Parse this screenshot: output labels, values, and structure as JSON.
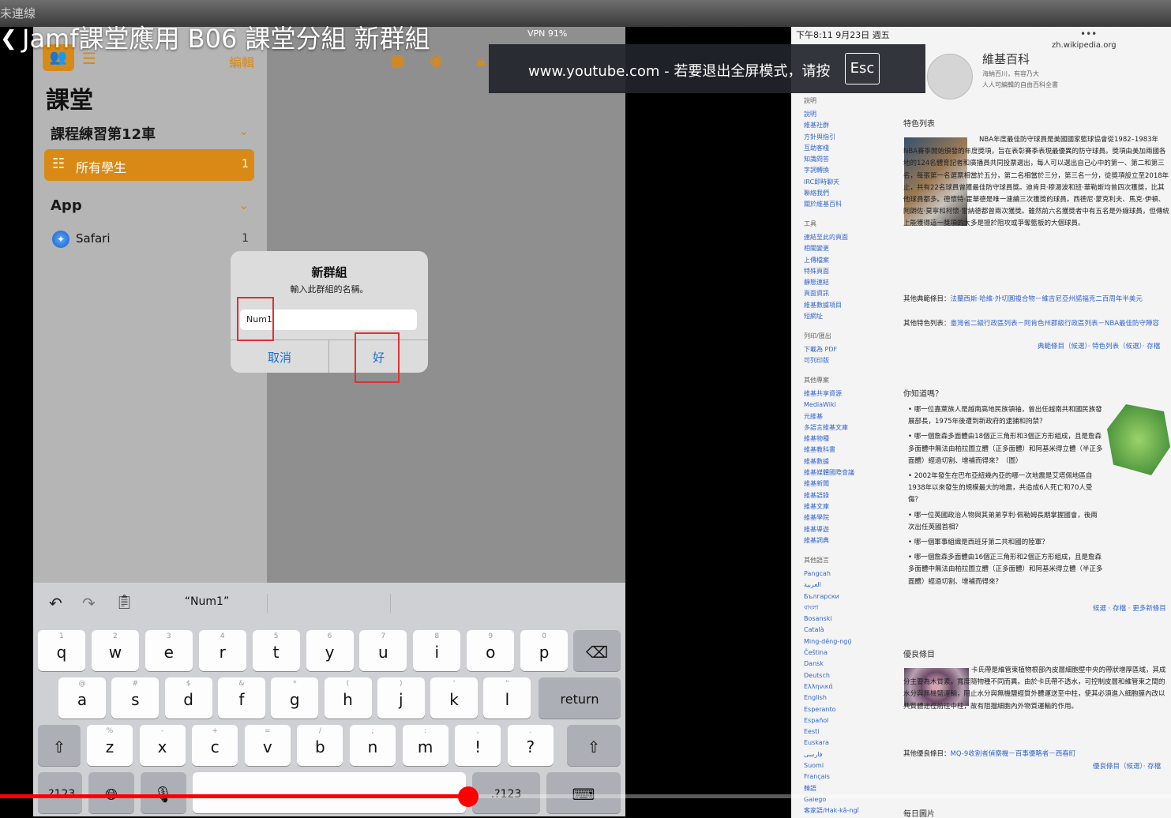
{
  "video": {
    "top_strip_text": "未連線",
    "title": "Jamf課堂應用 B06 課堂分組 新群組",
    "back_icon": "chevron-left-icon",
    "progress_fraction": 0.4
  },
  "ipad": {
    "status_bar": "VPN  91%",
    "sidebar": {
      "edit_label": "編輯",
      "title": "課堂",
      "section1": "課程練習第12車",
      "all_students_label": "所有學生",
      "all_students_count": "1",
      "section2": "App",
      "safari_label": "Safari",
      "safari_count": "1"
    },
    "dialog": {
      "title": "新群組",
      "message": "輸入此群組的名稱。",
      "input_value": "Num1",
      "cancel_label": "取消",
      "ok_label": "好"
    },
    "keyboard": {
      "suggestion": "“Num1”",
      "row1": [
        {
          "k": "q",
          "h": "1"
        },
        {
          "k": "w",
          "h": "2"
        },
        {
          "k": "e",
          "h": "3"
        },
        {
          "k": "r",
          "h": "4"
        },
        {
          "k": "t",
          "h": "5"
        },
        {
          "k": "y",
          "h": "6"
        },
        {
          "k": "u",
          "h": "7"
        },
        {
          "k": "i",
          "h": "8"
        },
        {
          "k": "o",
          "h": "9"
        },
        {
          "k": "p",
          "h": "0"
        }
      ],
      "row2": [
        {
          "k": "a",
          "h": "@"
        },
        {
          "k": "s",
          "h": "#"
        },
        {
          "k": "d",
          "h": "$"
        },
        {
          "k": "f",
          "h": "&"
        },
        {
          "k": "g",
          "h": "*"
        },
        {
          "k": "h",
          "h": "("
        },
        {
          "k": "j",
          "h": ")"
        },
        {
          "k": "k",
          "h": "'"
        },
        {
          "k": "l",
          "h": "\""
        }
      ],
      "row3": [
        {
          "k": "z",
          "h": "%"
        },
        {
          "k": "x",
          "h": "-"
        },
        {
          "k": "c",
          "h": "+"
        },
        {
          "k": "v",
          "h": "="
        },
        {
          "k": "b",
          "h": "/"
        },
        {
          "k": "n",
          "h": ";"
        },
        {
          "k": "m",
          "h": ":"
        },
        {
          "k": "!",
          "h": ","
        },
        {
          "k": "?",
          "h": "."
        }
      ],
      "return_label": "return",
      "num_label": ".?123"
    }
  },
  "notice": {
    "text": "www.youtube.com - 若要退出全屏模式，请按",
    "esc_label": "Esc"
  },
  "wiki": {
    "status_time": "下午8:11  9月23日 週五",
    "url": "zh.wikipedia.org",
    "site_name": "維基百科",
    "site_sub1": "海納百川，有容乃大",
    "site_sub2": "人人可編輯的自由百科全書",
    "nav_heading": "說明",
    "nav_items": [
      "說明",
      "維基社群",
      "方針與指引",
      "互助客棧",
      "知識問答",
      "字詞轉換",
      "IRC即時聊天",
      "聯絡我們",
      "關於維基百科"
    ],
    "tools_heading": "工具",
    "tools_items": [
      "連結至此的頁面",
      "相關變更",
      "上傳檔案",
      "特殊頁面",
      "靜態連結",
      "頁面資訊",
      "維基數據項目",
      "短網址"
    ],
    "print_heading": "列印/匯出",
    "print_items": [
      "下載為 PDF",
      "可列印版"
    ],
    "other_heading": "其他專案",
    "other_items": [
      "維基共享資源",
      "MediaWiki",
      "元維基",
      "多語言維基文庫",
      "維基物種",
      "維基教科書",
      "維基數據",
      "維基媒體國際會議",
      "維基新聞",
      "維基語錄",
      "維基文庫",
      "維基學院",
      "維基導遊",
      "維基詞典"
    ],
    "lang_heading": "其他語言",
    "languages": [
      "Pangcah",
      "العربية",
      "Български",
      "বাংলা",
      "Bosanski",
      "Català",
      "Ming-dĕng-ngṳ̄",
      "Čeština",
      "Dansk",
      "Deutsch",
      "Ελληνικά",
      "English",
      "Esperanto",
      "Español",
      "Eesti",
      "Euskara",
      "فارسی",
      "Suomi",
      "Français",
      "韓語",
      "Galego",
      "客家語/Hak-kâ-ngî"
    ],
    "featured_heading": "特色列表",
    "featured_text": "NBA年度最佳防守球員是美國國家籃球協會從1982–1983年NBA賽季開始頒發的年度獎項，旨在表彰賽季表現最優異的防守球員。獎項由美加兩國各地的124名體育記者和廣播員共同投票選出，每人可以選出自己心中的第一、第二和第三名，每張第一名選票相當於五分，第二名相當於三分，第三名一分，從獎項設立至2018年止，共有22名球員曾獲最佳防守球員獎。迪肯貝·穆湯波和班·華勒斯均曾四次獲獎，比其他球員都多。德懷特·霍華德是唯一連續三次獲獎的球員。西德尼·蒙克利夫、馬克·伊頓、阿朗佐·莫寧和柯懷·雷納德都曾兩次獲獎。雖然前六名獲獎者中有五名是外線球員，但傳統上能獲得這一獎項的大多是擅於阻攻或爭奪籃板的大個球員。",
    "featured_other1_label": "其他典範條目：",
    "featured_other1": "法蘭西斯·哈維·外切圓複合物－維吉尼亞州諾福克二百周年半美元",
    "featured_other2_label": "其他特色列表：",
    "featured_other2": "臺灣省二級行政區列表－阿肯色州郡級行政區列表－NBA最佳防守陣容",
    "featured_footer": "典範條目（候選）· 特色列表（候選）· 存檔",
    "dyk_heading": "你知道嗎？",
    "dyk_items": [
      "哪一位嘉萊族人是越南高地民族領袖，曾出任越南共和國民族發展部長，1975年後遭到新政府的逮捕和拘禁？",
      "哪一個詹森多面體由18個正三角形和3個正方形組成，且是詹森多面體中無法由柏拉圖立體（正多面體）和阿基米得立體（半正多面體）經過切割、增補而得來？（圖）",
      "2002年發生在巴布亞紐幾內亞的哪一次地震是艾塔佩地區自1938年以來發生的規模最大的地震，共造成6人死亡和70人受傷？",
      "哪一位英國政治人物與其弟弟亨利·佩勒姆長期掌握國會，後兩次出任英國首相？",
      "哪一個軍事組織是西班牙第二共和國的陸軍？",
      "哪一個詹森多面體由16個正三角形和2個正方形組成，且是詹森多面體中無法由柏拉圖立體（正多面體）和阿基米得立體（半正多面體）經過切割、增補而得來？"
    ],
    "dyk_footer": "候選 · 存檔 · 更多新條目",
    "good_heading": "優良條目",
    "good_text": "卡氏帶是維管束植物根部內皮層細胞壁中央的帶狀增厚區域，其成分主要為木質素，寬度隨物種不同而異。由於卡氏帶不透水，可控制皮層和維管束之間的水分與無機鹽運輸，阻止水分與無機鹽經質外體運送至中柱，使其必須進入細胞膜內改以共質體途徑前往中柱，故有阻擋細胞內外物質運輸的作用。",
    "good_other_label": "其他優良條目：",
    "good_other": "MQ-9收割者偵察機－百事優略者－西春町",
    "good_footer": "優良條目（候選）· 存檔",
    "daily_heading": "每日圖片"
  }
}
